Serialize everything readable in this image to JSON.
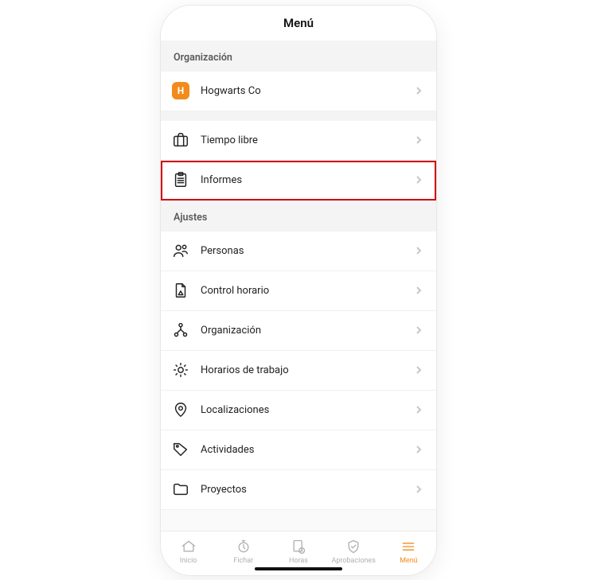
{
  "header": {
    "title": "Menú"
  },
  "sections": {
    "org": {
      "header": "Organización",
      "company": {
        "initial": "H",
        "name": "Hogwarts Co"
      }
    },
    "main": {
      "time_off": "Tiempo libre",
      "reports": "Informes"
    },
    "settings": {
      "header": "Ajustes",
      "people": "Personas",
      "time_control": "Control horario",
      "organization": "Organización",
      "work_schedules": "Horarios de trabajo",
      "locations": "Localizaciones",
      "activities": "Actividades",
      "projects": "Proyectos"
    }
  },
  "tabs": {
    "home": "Inicio",
    "clock": "Fichar",
    "hours": "Horas",
    "approvals": "Aprobaciones",
    "menu": "Menú"
  },
  "colors": {
    "accent": "#f28b1c",
    "highlight": "#d00000"
  },
  "highlighted": "reports"
}
